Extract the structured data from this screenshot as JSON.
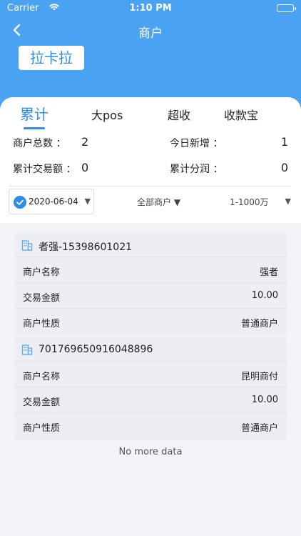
{
  "status_bar": {
    "carrier": "Carrier",
    "time": "1:10 PM"
  },
  "nav": {
    "title": "商户",
    "back_icon": "chevron-left-icon"
  },
  "merchant_chip": "拉卡拉",
  "tabs": [
    {
      "label": "累计",
      "active": true
    },
    {
      "label": "大pos",
      "active": false
    },
    {
      "label": "超收",
      "active": false
    },
    {
      "label": "收款宝",
      "active": false
    }
  ],
  "stats": {
    "total_merchants_label": "商户总数 ：",
    "total_merchants_value": "2",
    "today_new_label": "今日新增 ：",
    "today_new_value": "1",
    "total_amount_label": "累计交易额 ：",
    "total_amount_value": "0",
    "total_profit_label": "累计分润 ：",
    "total_profit_value": "0"
  },
  "filters": {
    "date": "2020-06-04",
    "date_arrow": "▼",
    "merchant_type": "全部商户 ▼",
    "range": "1-1000万",
    "range_arrow": "▼"
  },
  "merchants": [
    {
      "header": "者强-15398601021",
      "rows": [
        {
          "label": "商户名称",
          "value": "强者"
        },
        {
          "label": "交易金额",
          "value": "10.00"
        },
        {
          "label": "商户性质",
          "value": "普通商户"
        }
      ]
    },
    {
      "header": "701769650916048896",
      "rows": [
        {
          "label": "商户名称",
          "value": "昆明商付"
        },
        {
          "label": "交易金额",
          "value": "10.00"
        },
        {
          "label": "商户性质",
          "value": "普通商户"
        }
      ]
    }
  ],
  "footer": {
    "no_more": "No more data"
  },
  "colors": {
    "primary": "#4aa3f2",
    "accent": "#2e8de6",
    "list_bg": "#f3f4f7",
    "card_bg": "#eceef3"
  }
}
